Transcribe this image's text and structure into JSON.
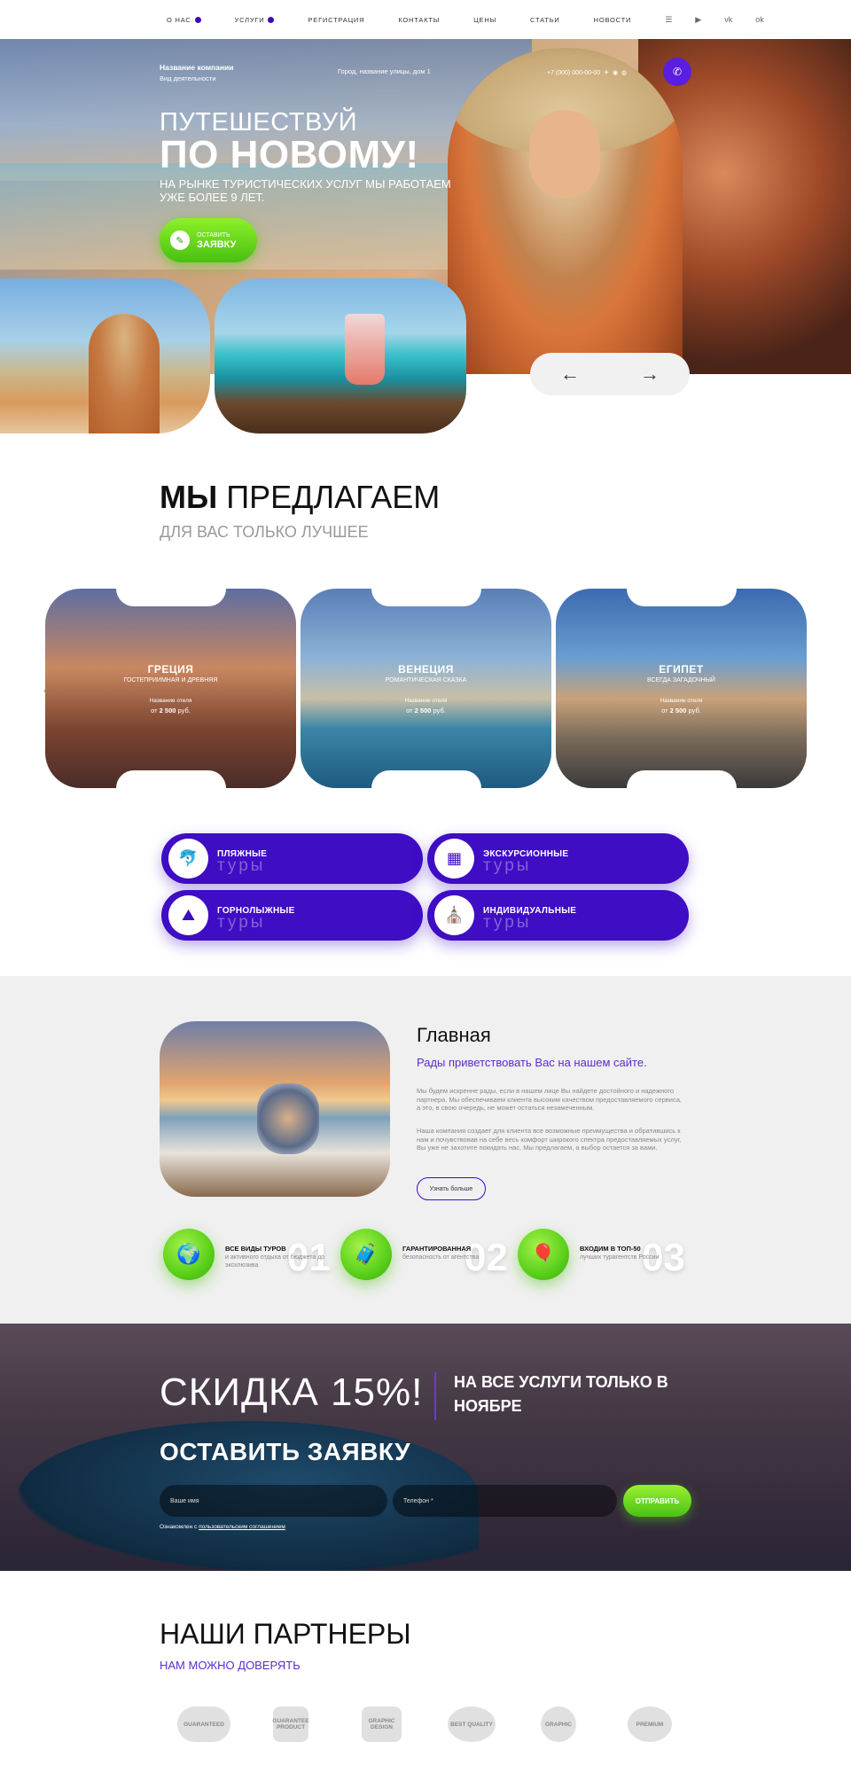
{
  "nav": {
    "items": [
      {
        "label": "О НАС",
        "dropdown": true
      },
      {
        "label": "УСЛУГИ",
        "dropdown": true
      },
      {
        "label": "РЕГИСТРАЦИЯ",
        "dropdown": false
      },
      {
        "label": "КОНТАКТЫ",
        "dropdown": false
      },
      {
        "label": "ЦЕНЫ",
        "dropdown": false
      },
      {
        "label": "СТАТЬИ",
        "dropdown": false
      },
      {
        "label": "НОВОСТИ",
        "dropdown": false
      }
    ],
    "icons": [
      "menu-icon",
      "youtube-icon",
      "vk-icon",
      "ok-icon"
    ]
  },
  "hero": {
    "company_name": "Название компании",
    "company_type": "Вид деятельности",
    "address": "Город, название улицы, дом 1",
    "phone": "+7 (000) 000-00-00",
    "subtitle": "ПУТЕШЕСТВУЙ",
    "title": "ПО НОВОМУ!",
    "description": "НА РЫНКЕ ТУРИСТИЧЕСКИХ УСЛУГ МЫ РАБОТАЕМ УЖЕ БОЛЕЕ 9 ЛЕТ.",
    "cta_small": "ОСТАВИТЬ",
    "cta_big": "ЗАЯВКУ",
    "prev_arrow": "←",
    "next_arrow": "→"
  },
  "offer": {
    "title_bold": "МЫ",
    "title_rest": "ПРЕДЛАГАЕМ",
    "subtitle": "ДЛЯ ВАС ТОЛЬКО ЛУЧШЕЕ",
    "cards": [
      {
        "name": "ГРЕЦИЯ",
        "tag": "ГОСТЕПРИИМНАЯ И ДРЕВНЯЯ",
        "hotel": "Название отеля",
        "price_prefix": "от",
        "price": "2 500",
        "currency": "руб."
      },
      {
        "name": "ВЕНЕЦИЯ",
        "tag": "РОМАНТИЧЕСКАЯ СКАЗКА",
        "hotel": "Название отеля",
        "price_prefix": "от",
        "price": "2 500",
        "currency": "руб."
      },
      {
        "name": "ЕГИПЕТ",
        "tag": "ВСЕГДА ЗАГАДОЧНЫЙ",
        "hotel": "Название отеля",
        "price_prefix": "от",
        "price": "2 500",
        "currency": "руб."
      }
    ],
    "tours": [
      {
        "top": "ПЛЯЖНЫЕ",
        "bottom": "туры",
        "icon": "dolphin-icon"
      },
      {
        "top": "ЭКСКУРСИОННЫЕ",
        "bottom": "туры",
        "icon": "building-icon"
      },
      {
        "top": "ГОРНОЛЫЖНЫЕ",
        "bottom": "туры",
        "icon": "mountain-icon"
      },
      {
        "top": "ИНДИВИДУАЛЬНЫЕ",
        "bottom": "туры",
        "icon": "landmark-icon"
      }
    ]
  },
  "main": {
    "title": "Главная",
    "subtitle": "Рады приветствовать Вас на нашем сайте.",
    "p1": "Мы будем искренне рады, если в нашем лице Вы найдете достойного и надежного партнера. Мы обеспечиваем клиента высоким качеством предоставляемого сервиса, а это, в свою очередь, не может остаться незамеченным.",
    "p2": "Наша компания создает для клиента все возможные преимущества и обратившись к нам и почувствовав на себе весь комфорт широкого спектра предоставляемых услуг, Вы уже не захотите покидать нас. Мы предлагаем, а выбор остается за вами.",
    "more": "Узнать больше",
    "features": [
      {
        "title": "ВСЕ ВИДЫ ТУРОВ",
        "desc": "и активного отдыха от бюджета до эксклюзива",
        "num": "01",
        "icon": "globe-icon"
      },
      {
        "title": "ГАРАНТИРОВАННАЯ",
        "desc": "безопасность от агентства",
        "num": "02",
        "icon": "luggage-icon"
      },
      {
        "title": "ВХОДИМ В ТОП-50",
        "desc": "лучших турагентств России",
        "num": "03",
        "icon": "balloon-icon"
      }
    ]
  },
  "promo": {
    "discount": "СКИДКА 15%!",
    "right_text": "НА ВСЕ УСЛУГИ ТОЛЬКО В НОЯБРЕ",
    "title": "ОСТАВИТЬ ЗАЯВКУ",
    "name_placeholder": "Ваше имя",
    "phone_placeholder": "Телефон *",
    "send": "ОТПРАВИТЬ",
    "agree_prefix": "Ознакомлен с",
    "agree_link": "пользовательским соглашением"
  },
  "partners": {
    "title": "НАШИ ПАРТНЕРЫ",
    "subtitle": "НАМ МОЖНО ДОВЕРЯТЬ",
    "badges": [
      "GUARANTEED",
      "GUARANTEE PRODUCT",
      "GRAPHIC DESIGN",
      "BEST QUALITY",
      "GRAPHIC",
      "Premium"
    ]
  }
}
